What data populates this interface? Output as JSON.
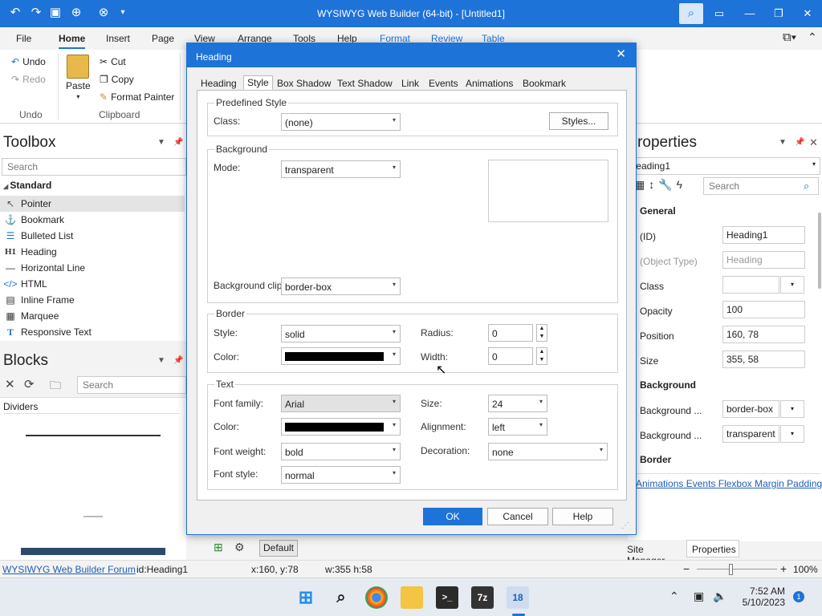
{
  "window": {
    "title": "WYSIWYG Web Builder (64-bit) - [Untitled1]"
  },
  "menus": [
    "File",
    "Home",
    "Insert",
    "Page",
    "View",
    "Arrange",
    "Tools",
    "Help",
    "Format",
    "Review",
    "Table"
  ],
  "ribbon": {
    "undo": "Undo",
    "redo": "Redo",
    "paste": "Paste",
    "cut": "Cut",
    "copy": "Copy",
    "format_painter": "Format Painter",
    "group_undo": "Undo",
    "group_clipboard": "Clipboard"
  },
  "toolbox": {
    "title": "Toolbox",
    "search_placeholder": "Search",
    "section": "Standard",
    "items": [
      {
        "label": "Pointer"
      },
      {
        "label": "Bookmark"
      },
      {
        "label": "Bulleted List"
      },
      {
        "label": "Heading"
      },
      {
        "label": "Horizontal Line"
      },
      {
        "label": "HTML"
      },
      {
        "label": "Inline Frame"
      },
      {
        "label": "Marquee"
      },
      {
        "label": "Responsive Text"
      }
    ]
  },
  "blocks": {
    "title": "Blocks",
    "search_placeholder": "Search",
    "section": "Dividers"
  },
  "properties": {
    "title": "Properties",
    "object": "Heading1",
    "search_placeholder": "Search",
    "general": "General",
    "rows": [
      {
        "label": "(ID)",
        "value": "Heading1"
      },
      {
        "label": "(Object Type)",
        "value": "Heading"
      },
      {
        "label": "Class",
        "value": ""
      },
      {
        "label": "Opacity",
        "value": "100"
      },
      {
        "label": "Position",
        "value": "160, 78"
      },
      {
        "label": "Size",
        "value": "355, 58"
      }
    ],
    "background": "Background",
    "bg_rows": [
      {
        "label": "Background ...",
        "value": "border-box"
      },
      {
        "label": "Background ...",
        "value": "transparent"
      }
    ],
    "border": "Border",
    "links": [
      "Animations",
      "Events",
      "Flexbox",
      "Margin",
      "Padding"
    ],
    "tabs": [
      "Site Manager",
      "Properties"
    ]
  },
  "dialog": {
    "title": "Heading",
    "tabs": [
      "Heading",
      "Style",
      "Box Shadow",
      "Text Shadow",
      "Link",
      "Events",
      "Animations",
      "Bookmark"
    ],
    "predefined": {
      "legend": "Predefined Style",
      "class_label": "Class:",
      "class_value": "(none)",
      "styles_btn": "Styles..."
    },
    "background": {
      "legend": "Background",
      "mode_label": "Mode:",
      "mode_value": "transparent",
      "clip_label": "Background clip:",
      "clip_value": "border-box"
    },
    "border": {
      "legend": "Border",
      "style_label": "Style:",
      "style_value": "solid",
      "color_label": "Color:",
      "radius_label": "Radius:",
      "radius_value": "0",
      "width_label": "Width:",
      "width_value": "0"
    },
    "text": {
      "legend": "Text",
      "family_label": "Font family:",
      "family_value": "Arial",
      "color_label": "Color:",
      "weight_label": "Font weight:",
      "weight_value": "bold",
      "style_label": "Font style:",
      "style_value": "normal",
      "size_label": "Size:",
      "size_value": "24",
      "align_label": "Alignment:",
      "align_value": "left",
      "decoration_label": "Decoration:",
      "decoration_value": "none"
    },
    "buttons": {
      "ok": "OK",
      "cancel": "Cancel",
      "help": "Help"
    }
  },
  "bottom": {
    "default_btn": "Default"
  },
  "statusbar": {
    "forum": "WYSIWYG Web Builder Forum",
    "id": "id:Heading1",
    "pos": "x:160, y:78",
    "size": "w:355 h:58",
    "zoom": "100%"
  },
  "taskbar": {
    "time": "7:52 AM",
    "date": "5/10/2023",
    "notif": "1"
  }
}
